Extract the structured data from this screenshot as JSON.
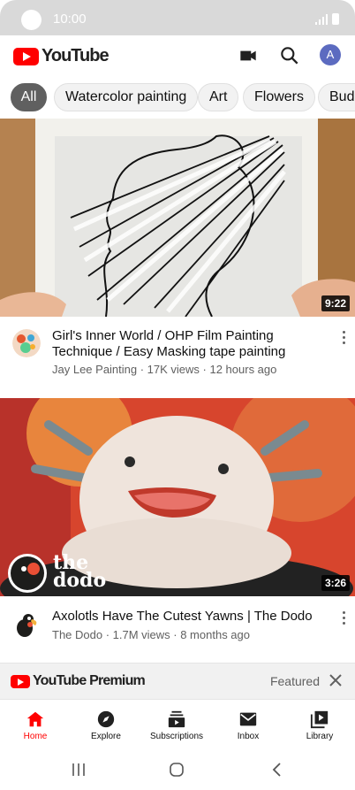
{
  "status_bar": {
    "time": "10:00"
  },
  "app_bar": {
    "logo_text": "YouTube",
    "icons": [
      "video-camera-icon",
      "search-icon"
    ],
    "avatar_letter": "A"
  },
  "chips": [
    {
      "label": "All",
      "active": true
    },
    {
      "label": "Watercolor painting",
      "active": false
    },
    {
      "label": "Art",
      "active": false
    },
    {
      "label": "Flowers",
      "active": false
    },
    {
      "label": "Budg",
      "active": false
    }
  ],
  "videos": [
    {
      "title": "Girl's Inner World / OHP Film  Painting Technique / Easy Masking tape painting",
      "subtitle": "Jay Lee Painting · 17K views · 12 hours ago",
      "duration": "9:22"
    },
    {
      "title": "Axolotls Have The Cutest Yawns | The Dodo",
      "subtitle": "The Dodo · 1.7M views · 8 months ago",
      "duration": "3:26",
      "watermark_top": "the",
      "watermark_bottom": "dodo"
    }
  ],
  "premium_banner": {
    "logo_text": "YouTube Premium",
    "featured_label": "Featured"
  },
  "bottom_nav": [
    {
      "label": "Home",
      "icon": "home-icon",
      "active": true
    },
    {
      "label": "Explore",
      "icon": "compass-icon",
      "active": false
    },
    {
      "label": "Subscriptions",
      "icon": "subscriptions-icon",
      "active": false
    },
    {
      "label": "Inbox",
      "icon": "mail-icon",
      "active": false
    },
    {
      "label": "Library",
      "icon": "library-icon",
      "active": false
    }
  ],
  "colors": {
    "brand_red": "#ff0000",
    "chip_active": "#606060",
    "avatar": "#5c6bc0"
  }
}
